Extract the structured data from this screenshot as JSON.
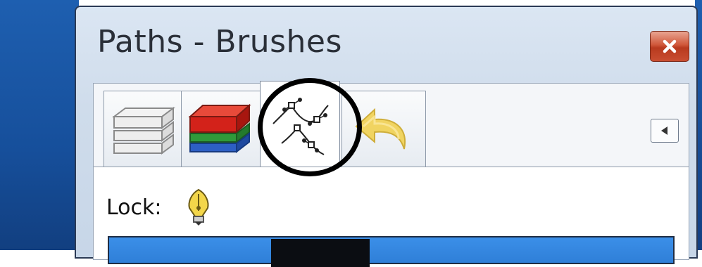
{
  "window": {
    "title": "Paths - Brushes",
    "close_icon": "close-icon"
  },
  "tabs": [
    {
      "name": "layers",
      "icon": "layers-icon",
      "active": false
    },
    {
      "name": "channels",
      "icon": "channels-icon",
      "active": false
    },
    {
      "name": "paths",
      "icon": "paths-icon",
      "active": true
    },
    {
      "name": "undo-history",
      "icon": "undo-icon",
      "active": false
    }
  ],
  "panel_menu": {
    "icon": "triangle-left-icon"
  },
  "content": {
    "lock_label": "Lock:",
    "lock_icon": "pen-lock-icon"
  },
  "colors": {
    "desktop": "#1e5fb0",
    "close_button": "#c94e31",
    "selected_row": "#3b8fe8",
    "highlight_ring": "#000000"
  }
}
